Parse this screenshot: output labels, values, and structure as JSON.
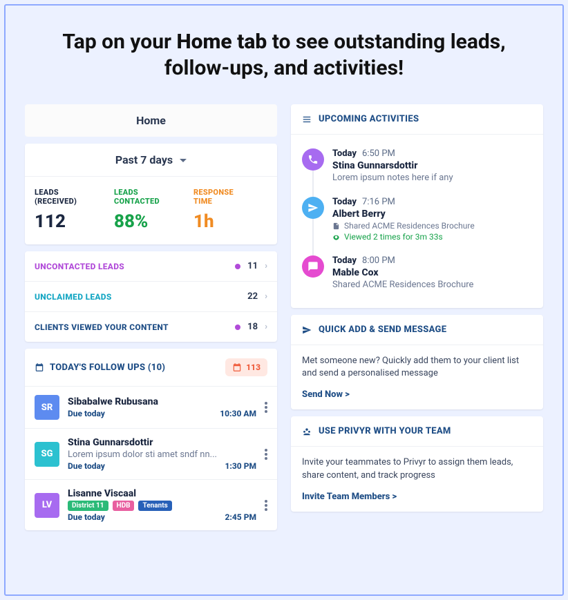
{
  "headline": {
    "part1": "Tap on your ",
    "bold": "Home tab",
    "part2": " to see outstanding leads, follow-ups, and activities!"
  },
  "home": {
    "title": "Home",
    "range": "Past 7 days"
  },
  "stats": {
    "received": {
      "label1": "LEADS",
      "label2": "(RECEIVED)",
      "value": "112"
    },
    "contacted": {
      "label1": "LEADS",
      "label2": "CONTACTED",
      "value": "88%"
    },
    "response": {
      "label1": "RESPONSE",
      "label2": "TIME",
      "value": "1h"
    }
  },
  "rows": {
    "uncontacted": {
      "label": "UNCONTACTED LEADS",
      "count": "11"
    },
    "unclaimed": {
      "label": "UNCLAIMED LEADS",
      "count": "22"
    },
    "viewed": {
      "label": "CLIENTS VIEWED YOUR CONTENT",
      "count": "18"
    }
  },
  "followups": {
    "header": "TODAY'S FOLLOW UPS (10)",
    "badge": "113",
    "items": [
      {
        "initials": "SR",
        "name": "Sibabalwe Rubusana",
        "due": "Due today",
        "time": "10:30 AM"
      },
      {
        "initials": "SG",
        "name": "Stina Gunnarsdottir",
        "note": "Lorem ipsum dolor sti amet sndf nn...",
        "due": "Due today",
        "time": "1:30 PM"
      },
      {
        "initials": "LV",
        "name": "Lisanne Viscaal",
        "due": "Due today",
        "time": "2:45 PM",
        "tags": [
          "District 11",
          "HDB",
          "Tenants"
        ]
      }
    ]
  },
  "upcoming": {
    "header": "UPCOMING ACTIVITIES",
    "items": [
      {
        "day": "Today",
        "time": "6:50 PM",
        "name": "Stina Gunnarsdottir",
        "note": "Lorem ipsum notes here if any"
      },
      {
        "day": "Today",
        "time": "7:16 PM",
        "name": "Albert Berry",
        "share": "Shared ACME Residences Brochure",
        "view": "Viewed 2 times for 3m 33s"
      },
      {
        "day": "Today",
        "time": "8:00 PM",
        "name": "Mable Cox",
        "share": "Shared ACME Residences Brochure"
      }
    ]
  },
  "quickadd": {
    "header": "QUICK ADD & SEND MESSAGE",
    "text": "Met someone new? Quickly add them to your client list and send a personalised message",
    "link": "Send Now >"
  },
  "team": {
    "header": "USE PRIVYR WITH YOUR TEAM",
    "text": "Invite your teammates to Privyr to assign them leads, share content, and track progress",
    "link": "Invite Team Members >"
  }
}
